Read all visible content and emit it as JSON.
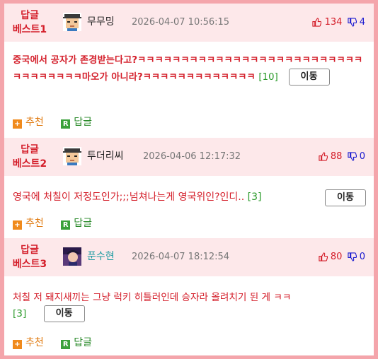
{
  "comments": [
    {
      "rank_line1": "답글",
      "rank_line2": "베스트1",
      "nickname": "무무밍",
      "datetime": "2026-04-07 10:56:15",
      "upvotes": "134",
      "downvotes": "4",
      "text": "중국에서 공자가 존경받는다고?ㅋㅋㅋㅋㅋㅋㅋㅋㅋㅋㅋㅋㅋㅋㅋㅋㅋㅋㅋㅋㅋㅋㅋㅋㅋㅋㅋㅋㅋㅋㅋㅋㅋㅋ마오가 아니라?ㅋㅋㅋㅋㅋㅋㅋㅋㅋㅋㅋㅋㅋ",
      "reply_count": "[10]",
      "move_label": "이동",
      "recommend_label": "추천",
      "reply_label": "답글"
    },
    {
      "rank_line1": "답글",
      "rank_line2": "베스트2",
      "nickname": "투더리씨",
      "datetime": "2026-04-06 12:17:32",
      "upvotes": "88",
      "downvotes": "0",
      "text": "영국에 처칠이 저정도인가;;;넘쳐나는게 영국위인?인디..",
      "reply_count": "[3]",
      "move_label": "이동",
      "recommend_label": "추천",
      "reply_label": "답글"
    },
    {
      "rank_line1": "답글",
      "rank_line2": "베스트3",
      "nickname": "푼수현",
      "datetime": "2026-04-07 18:12:54",
      "upvotes": "80",
      "downvotes": "0",
      "text": "처칠 저 돼지새끼는 그냥 럭키 히틀러인데 승자라 올려치기 된 게 ㅋㅋ",
      "reply_count": "[3]",
      "move_label": "이동",
      "recommend_label": "추천",
      "reply_label": "답글"
    }
  ],
  "icons": {
    "thumbs_up": "thumbs-up-icon",
    "thumbs_down": "thumbs-down-icon",
    "recommend": "plus-square-icon",
    "reply": "r-square-icon"
  },
  "colors": {
    "frame": "#f4a5ab",
    "header_bg": "#fde8ea",
    "accent_red": "#d41e2a",
    "count_green": "#2a9a2a",
    "down_blue": "#1a1ad0"
  }
}
